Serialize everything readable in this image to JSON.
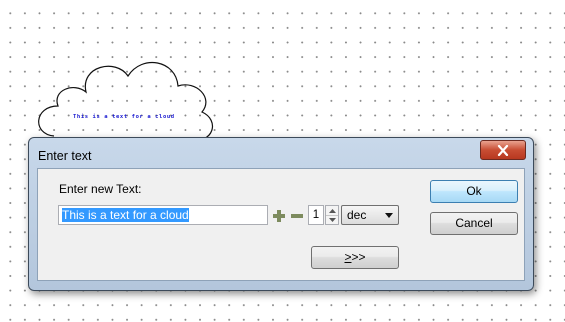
{
  "canvas": {
    "cloud_label": "This is a text for a cloud"
  },
  "dialog": {
    "title": "Enter text",
    "close_icon": "close-x",
    "prompt_label": "Enter new Text:",
    "text_value": "This is a text for a cloud",
    "plus_icon": "plus",
    "minus_icon": "minus",
    "count_value": "1",
    "unit_selected": "dec",
    "ok_label": "Ok",
    "cancel_label": "Cancel",
    "more_label_mnemonic": ">",
    "more_label_rest": ">>",
    "colors": {
      "accent": "#3399ff",
      "close_button": "#c84d33",
      "plus_minus": "#7d8b5e",
      "cloud_text": "#1a1ad0"
    }
  }
}
